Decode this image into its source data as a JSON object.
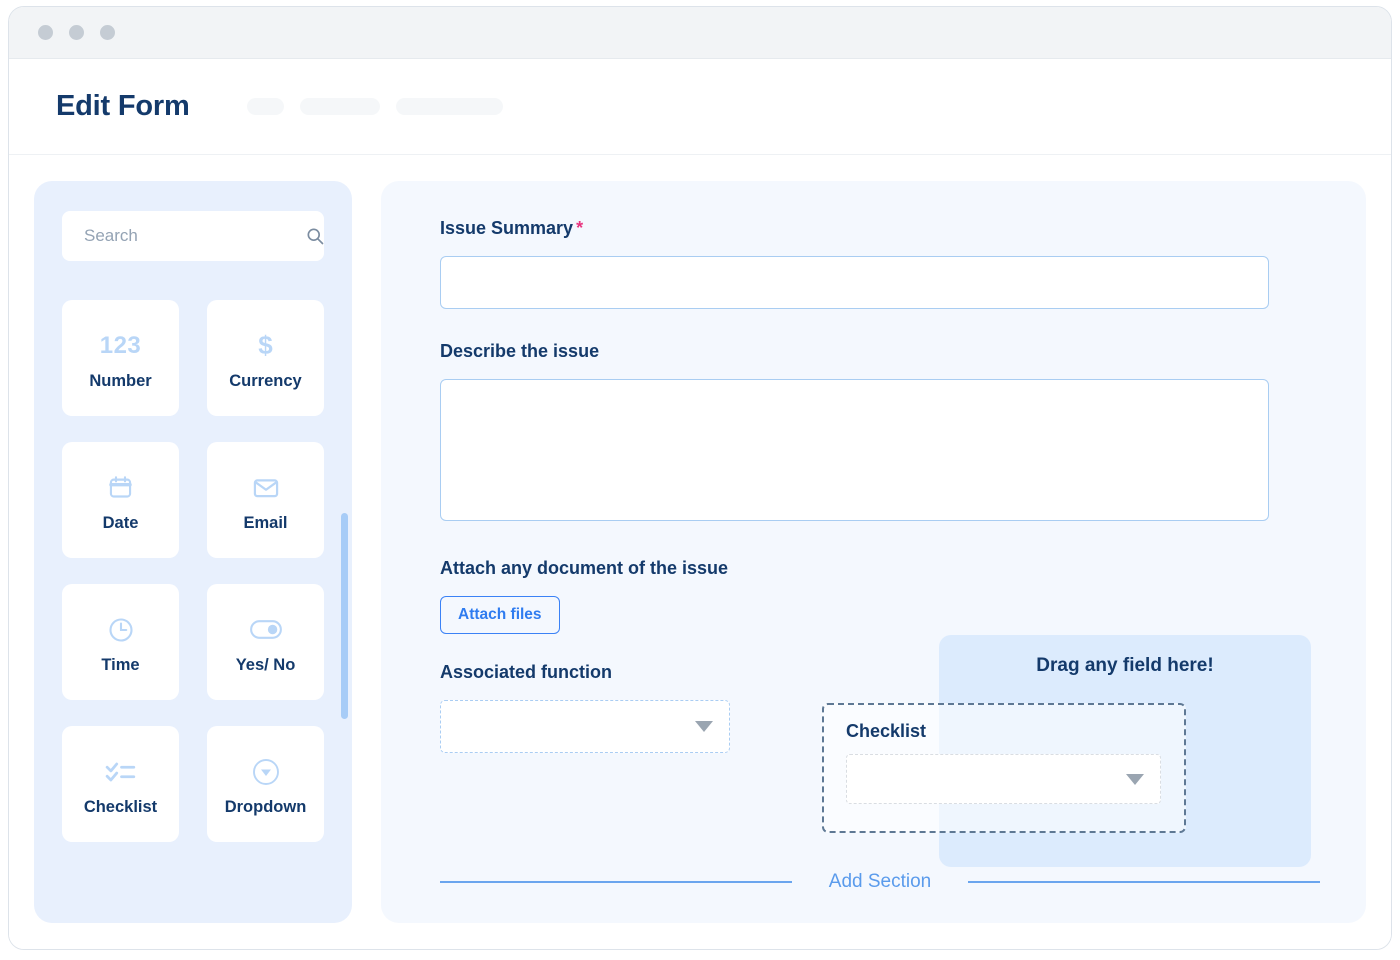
{
  "window": {
    "dots": [
      "close",
      "minimize",
      "maximize"
    ]
  },
  "header": {
    "title": "Edit Form",
    "skeleton_count": 3
  },
  "sidebar": {
    "search": {
      "placeholder": "Search",
      "value": "",
      "icon": "search-icon"
    },
    "fields": [
      {
        "label": "Number",
        "icon": "number-123-icon",
        "glyph": "123"
      },
      {
        "label": "Currency",
        "icon": "dollar-icon",
        "glyph": "$"
      },
      {
        "label": "Date",
        "icon": "calendar-icon",
        "glyph": ""
      },
      {
        "label": "Email",
        "icon": "envelope-icon",
        "glyph": ""
      },
      {
        "label": "Time",
        "icon": "clock-icon",
        "glyph": ""
      },
      {
        "label": "Yes/ No",
        "icon": "toggle-icon",
        "glyph": ""
      },
      {
        "label": "Checklist",
        "icon": "checklist-icon",
        "glyph": ""
      },
      {
        "label": "Dropdown",
        "icon": "dropdown-circle-icon",
        "glyph": ""
      }
    ],
    "scrollbar": {
      "name": "palette-scrollbar"
    }
  },
  "form": {
    "issue_summary": {
      "label": "Issue Summary",
      "required_marker": "*",
      "value": "",
      "placeholder": ""
    },
    "describe_issue": {
      "label": "Describe the issue",
      "value": "",
      "placeholder": ""
    },
    "attach": {
      "label": "Attach any document of the issue",
      "button_label": "Attach files"
    },
    "associated_function": {
      "label": "Associated function",
      "selected": "",
      "caret_icon": "caret-down-icon"
    },
    "dropzone": {
      "text": "Drag any field here!"
    },
    "drag_card": {
      "title": "Checklist",
      "selected": "",
      "caret_icon": "caret-down-icon"
    },
    "add_section": {
      "label": "Add Section"
    }
  },
  "colors": {
    "brand_navy": "#143a6b",
    "accent_blue": "#2f7cf0",
    "icon_blue": "#b9d6f7",
    "required_pink": "#e8357f",
    "panel_bg": "#f4f8fe",
    "palette_bg": "#e8f0fd",
    "dropzone_bg": "#dcebfd"
  }
}
